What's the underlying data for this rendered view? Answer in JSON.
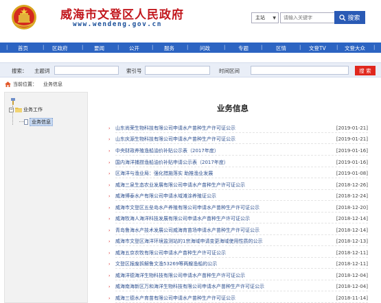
{
  "header": {
    "title": "威海市文登区人民政府",
    "url": "www.wendeng.gov.cn",
    "search_scope": "主站",
    "search_placeholder": "请输入关键字",
    "search_button": "搜索"
  },
  "nav": {
    "items": [
      "首页",
      "区政府",
      "要闻",
      "公开",
      "服务",
      "问政",
      "专题",
      "区情",
      "文登TV",
      "文登大众"
    ]
  },
  "subbar": {
    "topic_label": "搜索：",
    "theme_label": "主题词",
    "index_label": "索引号",
    "time_label": "时间区间",
    "search_button": "搜 索"
  },
  "breadcrumb": {
    "label": "当前位置：",
    "current": "业务信息"
  },
  "sidebar": {
    "parent": "业务工作",
    "child": "业务信息"
  },
  "main": {
    "title": "业务信息",
    "items": [
      {
        "title": "山东尚荣生物科技有限公司申请水产苗种生产许可证公示",
        "date": "[2019-01-21]"
      },
      {
        "title": "山东庆源生物科技有限公司申请水产苗种生产许可证公示",
        "date": "[2019-01-21]"
      },
      {
        "title": "中央财政养殖渔船油价补贴公示表（2017年度）",
        "date": "[2019-01-16]"
      },
      {
        "title": "国内海洋捕捞渔船油价补贴申请公示表（2017年度）",
        "date": "[2019-01-16]"
      },
      {
        "title": "区海洋与渔业局：强化措施落实 助推渔业发展",
        "date": "[2019-01-08]"
      },
      {
        "title": "威海三泉生态农业发展有限公司申请水产苗种生产许可证公示",
        "date": "[2018-12-26]"
      },
      {
        "title": "威海博泰水产有限公司申请水域滩涂养殖证公示",
        "date": "[2018-12-24]"
      },
      {
        "title": "威海市文登区五垒岛水产养殖有限公司申请水产苗种生产许可证公示",
        "date": "[2018-12-20]"
      },
      {
        "title": "威海牧海人海洋科技发展有限公司申请水产苗种生产许可证公示",
        "date": "[2018-12-14]"
      },
      {
        "title": "青岛鲁海水产技术发展公司威海育苗场申请水产苗种生产许可证公示",
        "date": "[2018-12-14]"
      },
      {
        "title": "威海市文登区海洋环境监测站的1宗海域申请变更海域使用性质的公示",
        "date": "[2018-12-13]"
      },
      {
        "title": "威海五京农牧有限公司申请水产苗种生产许可证公示",
        "date": "[2018-12-11]"
      },
      {
        "title": "文登区报废拆解鲁文渔53269等两艘渔船的公示",
        "date": "[2018-12-11]"
      },
      {
        "title": "威海洋德海洋生物科技有限公司申请水产苗种生产许可证公示",
        "date": "[2018-12-04]"
      },
      {
        "title": "威海南海新区万和海洋生物科技有限公司申请水产苗种生产许可证公示",
        "date": "[2018-12-04]"
      },
      {
        "title": "威海三德水产育苗有限公司申请水产苗种生产许可证公示",
        "date": "[2018-11-14]"
      }
    ]
  },
  "colors": {
    "brand_red": "#c2171d",
    "nav_blue": "#2c64c2",
    "link_blue": "#2e5090",
    "search_red": "#e0271d"
  }
}
